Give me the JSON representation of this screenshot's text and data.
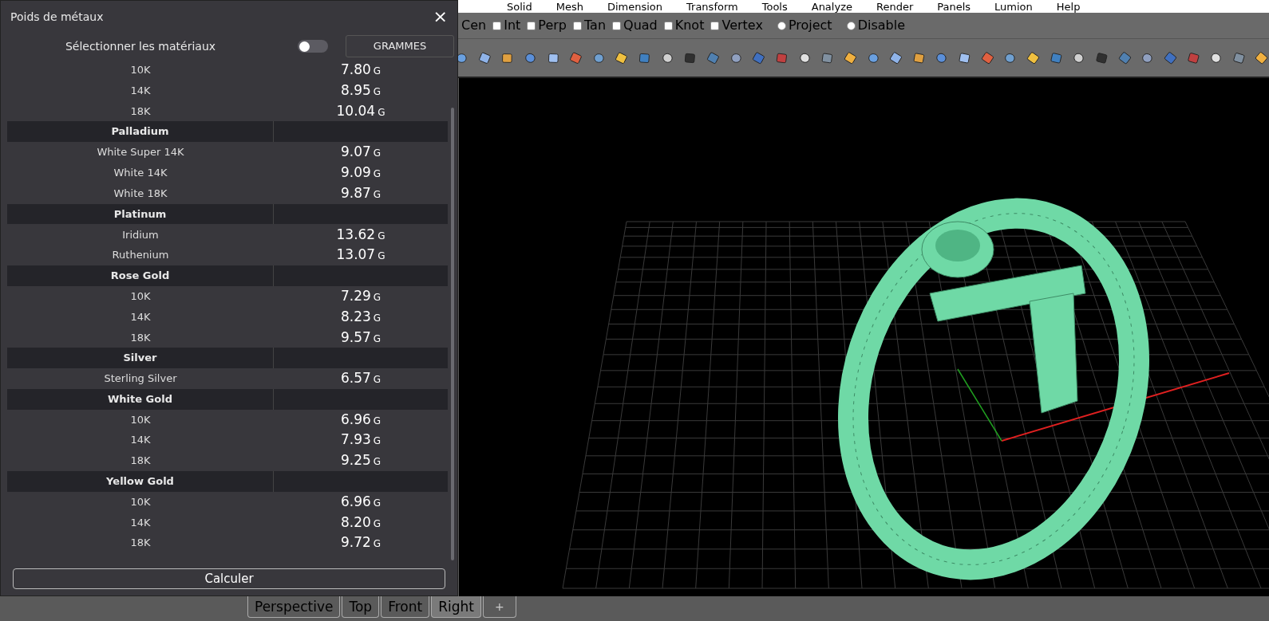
{
  "app": {
    "menu": [
      "Solid",
      "Mesh",
      "Dimension",
      "Transform",
      "Tools",
      "Analyze",
      "Render",
      "Panels",
      "Lumion",
      "Help"
    ],
    "osnaps": [
      {
        "label": "Cen",
        "kind": "plain"
      },
      {
        "label": "Int",
        "kind": "check",
        "checked": false
      },
      {
        "label": "Perp",
        "kind": "check",
        "checked": false
      },
      {
        "label": "Tan",
        "kind": "check",
        "checked": false
      },
      {
        "label": "Quad",
        "kind": "check",
        "checked": false
      },
      {
        "label": "Knot",
        "kind": "check",
        "checked": false
      },
      {
        "label": "Vertex",
        "kind": "check",
        "checked": false
      },
      {
        "label": "Project",
        "kind": "radio",
        "checked": false
      },
      {
        "label": "Disable",
        "kind": "radio",
        "checked": false
      }
    ],
    "viewport_tabs": [
      {
        "label": "Perspective",
        "selected": false
      },
      {
        "label": "Top",
        "selected": false
      },
      {
        "label": "Front",
        "selected": false
      },
      {
        "label": "Right",
        "selected": true
      }
    ],
    "add_tab": "+"
  },
  "dialog": {
    "title": "Poids de métaux",
    "close": "×",
    "select_label": "Sélectionner les matériaux",
    "select_toggle_on": false,
    "unit_button": "GRAMMES",
    "groups": [
      {
        "rows": [
          {
            "name": "10K",
            "value": "7.80",
            "unit": "G"
          },
          {
            "name": "14K",
            "value": "8.95",
            "unit": "G"
          },
          {
            "name": "18K",
            "value": "10.04",
            "unit": "G"
          }
        ]
      },
      {
        "name": "Palladium",
        "rows": [
          {
            "name": "White Super 14K",
            "value": "9.07",
            "unit": "G"
          },
          {
            "name": "White 14K",
            "value": "9.09",
            "unit": "G"
          },
          {
            "name": "White 18K",
            "value": "9.87",
            "unit": "G"
          }
        ]
      },
      {
        "name": "Platinum",
        "rows": [
          {
            "name": "Iridium",
            "value": "13.62",
            "unit": "G"
          },
          {
            "name": "Ruthenium",
            "value": "13.07",
            "unit": "G"
          }
        ]
      },
      {
        "name": "Rose Gold",
        "rows": [
          {
            "name": "10K",
            "value": "7.29",
            "unit": "G"
          },
          {
            "name": "14K",
            "value": "8.23",
            "unit": "G"
          },
          {
            "name": "18K",
            "value": "9.57",
            "unit": "G"
          }
        ]
      },
      {
        "name": "Silver",
        "rows": [
          {
            "name": "Sterling Silver",
            "value": "6.57",
            "unit": "G"
          }
        ]
      },
      {
        "name": "White Gold",
        "rows": [
          {
            "name": "10K",
            "value": "6.96",
            "unit": "G"
          },
          {
            "name": "14K",
            "value": "7.93",
            "unit": "G"
          },
          {
            "name": "18K",
            "value": "9.25",
            "unit": "G"
          }
        ]
      },
      {
        "name": "Yellow Gold",
        "rows": [
          {
            "name": "10K",
            "value": "6.96",
            "unit": "G"
          },
          {
            "name": "14K",
            "value": "8.20",
            "unit": "G"
          },
          {
            "name": "18K",
            "value": "9.72",
            "unit": "G"
          }
        ]
      }
    ],
    "calculate_button": "Calculer"
  }
}
